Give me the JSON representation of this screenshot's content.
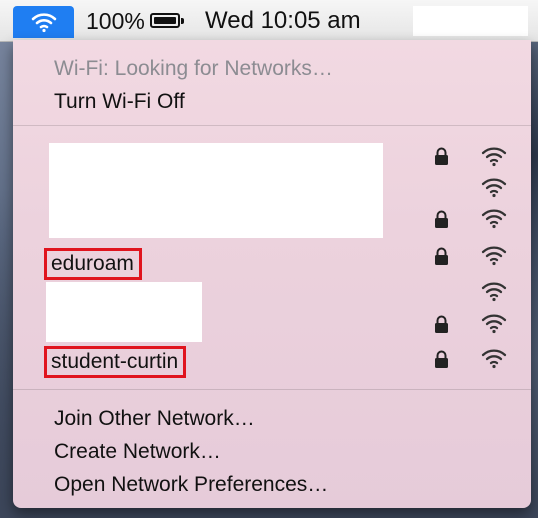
{
  "menubar": {
    "battery_percent": "100%",
    "battery_level": 1.0,
    "clock": "Wed 10:05 am"
  },
  "wifi_menu": {
    "status": "Wi-Fi: Looking for Networks…",
    "toggle_label": "Turn Wi-Fi Off",
    "networks": [
      {
        "name": "",
        "secured": true,
        "redacted": true
      },
      {
        "name": "",
        "secured": false,
        "redacted": true
      },
      {
        "name": "",
        "secured": true,
        "redacted": true
      },
      {
        "name": "eduroam",
        "secured": true,
        "redacted": false,
        "highlighted": true
      },
      {
        "name": "",
        "secured": false,
        "redacted": true
      },
      {
        "name": "",
        "secured": true,
        "redacted": true
      },
      {
        "name": "student-curtin",
        "secured": true,
        "redacted": false,
        "highlighted": true
      }
    ],
    "actions": {
      "join_other": "Join Other Network…",
      "create": "Create Network…",
      "open_prefs": "Open Network Preferences…"
    }
  },
  "colors": {
    "accent": "#1f7ef2",
    "highlight_box": "#e0141e",
    "menu_background": "#ecd2dd"
  },
  "icons": {
    "menubar_wifi": "wifi-icon",
    "battery": "battery-icon",
    "lock": "lock-icon",
    "signal": "wifi-signal-icon"
  }
}
